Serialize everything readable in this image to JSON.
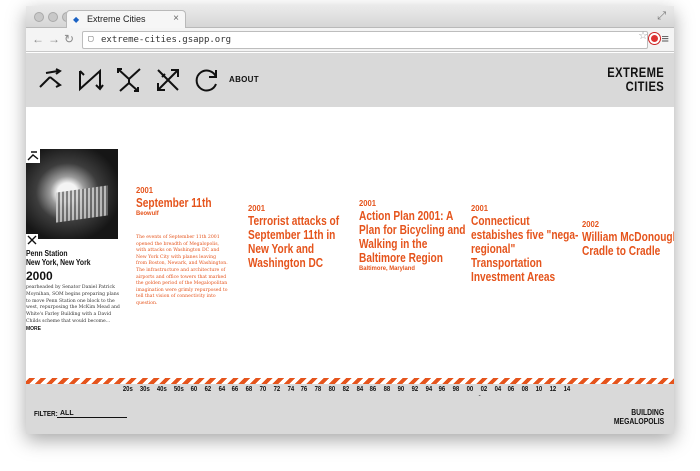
{
  "browser": {
    "tab_title": "Extreme Cities",
    "url": "extreme-cities.gsapp.org"
  },
  "nav": {
    "icons": [
      "split-arrows-icon",
      "zigzag-arrow-icon",
      "branching-arrows-icon",
      "crossed-arrows-icon",
      "refresh-icon"
    ],
    "about_label": "ABOUT"
  },
  "logo": {
    "line1": "EXTREME",
    "line2": "CITIES"
  },
  "featured": {
    "title_line1": "Penn Station",
    "title_line2": "New York, New York",
    "year": "2000",
    "body": "pearheaded by Senator Daniel Patrick Moynihan, SOM begins preparing plans to move Penn Station one block to the west, repurposing the McKim Mead and White's Farley Building with a David Childs scheme that would become...",
    "more_label": "MORE"
  },
  "events": [
    {
      "year": "2001",
      "title": "September 11th",
      "subtitle": "Beowulf",
      "description": "The events of September 11th 2001 opened the breadth of Megalopolis, with attacks on Washington DC and New York City with planes leaving from Boston, Newark, and Washington. The infrastructure and architecture of airports and office towers that marked the golden period of the Megalopolitan imagination were grimly repurposed to tell that vision of connectivity into question."
    },
    {
      "year": "2001",
      "title": "Terrorist attacks of September 11th in New York and Washington DC",
      "subtitle": "",
      "description": ""
    },
    {
      "year": "2001",
      "title": "Action Plan 2001: A Plan for Bicycling and Walking in the Baltimore Region",
      "subtitle": "Baltimore, Maryland",
      "description": ""
    },
    {
      "year": "2001",
      "title": "Connecticut estabishes five \"nega-regional\" Transportation Investment Areas",
      "subtitle": "",
      "description": ""
    },
    {
      "year": "2002",
      "title": "William McDonough, Cradle to Cradle",
      "subtitle": "",
      "description": ""
    }
  ],
  "decades": [
    "20s",
    "30s",
    "40s",
    "50s",
    "60",
    "62",
    "64",
    "66",
    "68",
    "70",
    "72",
    "74",
    "76",
    "78",
    "80",
    "82",
    "84",
    "86",
    "88",
    "90",
    "92",
    "94",
    "96",
    "98",
    "00",
    "02",
    "04",
    "06",
    "08",
    "10",
    "12",
    "14"
  ],
  "decade_selected": "02",
  "filter": {
    "label": "FILTER:",
    "value": "ALL"
  },
  "section": {
    "line1": "BUILDING",
    "line2": "MEGALOPOLIS"
  },
  "colors": {
    "accent": "#e5541c",
    "header_bg": "#d9d9d9",
    "text": "#111111"
  }
}
